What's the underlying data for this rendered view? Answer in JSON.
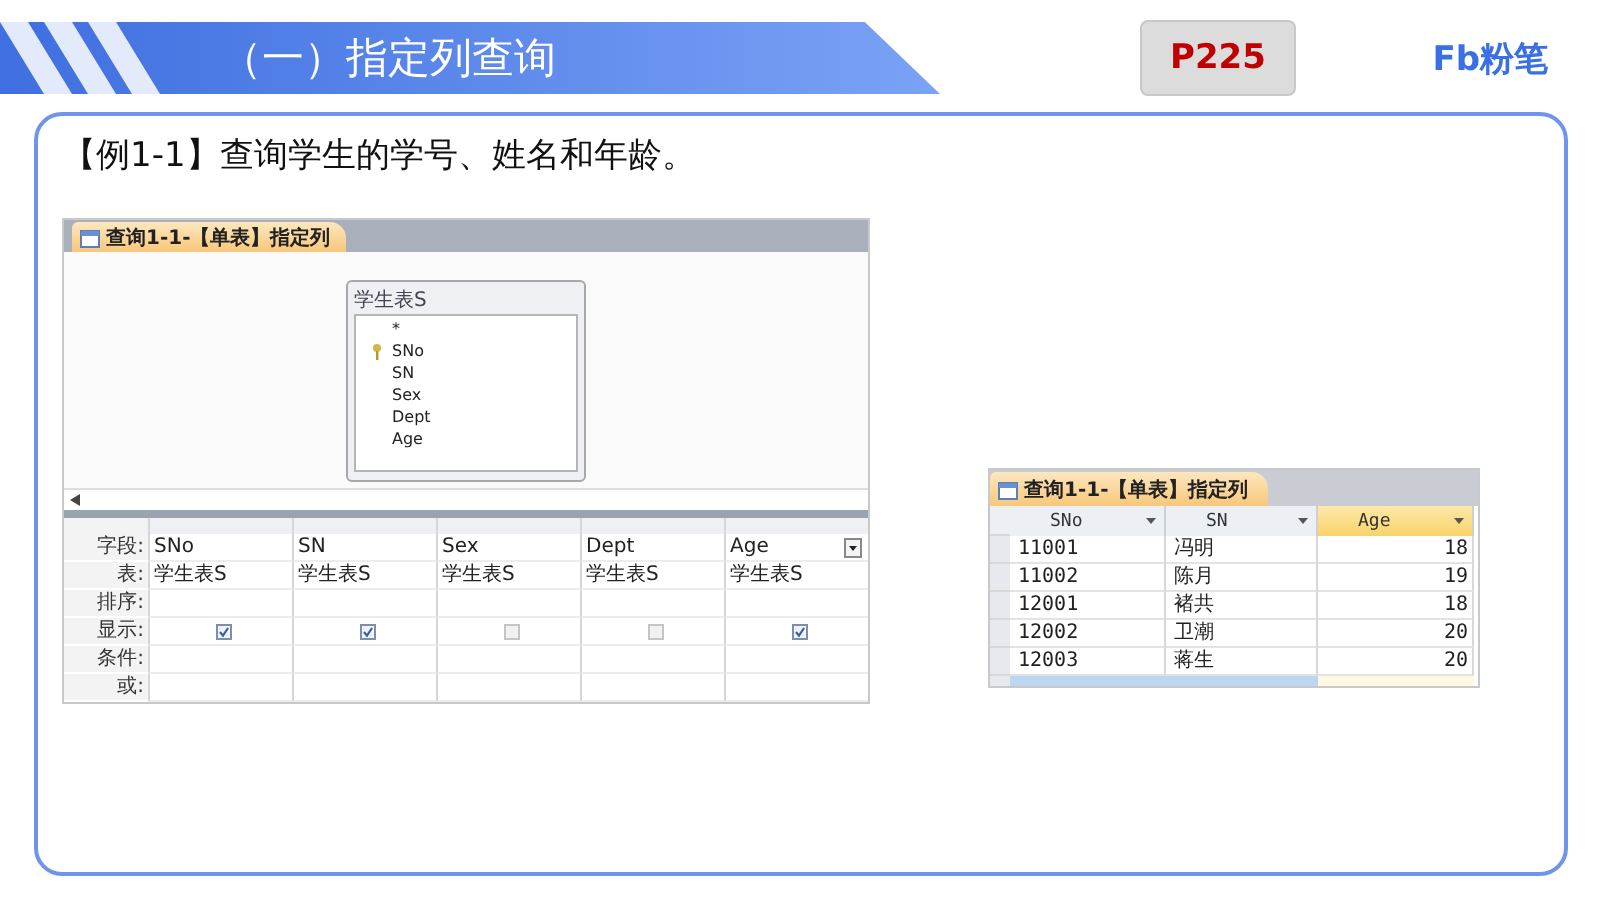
{
  "header": {
    "title": "（一）指定列查询",
    "page_badge": "P225",
    "logo": "Fb粉笔"
  },
  "question": "【例1-1】查询学生的学号、姓名和年龄。",
  "design_view": {
    "tab": "查询1-1-【单表】指定列",
    "table_box": {
      "title": "学生表S",
      "fields": [
        {
          "name": "*",
          "key": false
        },
        {
          "name": "SNo",
          "key": true
        },
        {
          "name": "SN",
          "key": false
        },
        {
          "name": "Sex",
          "key": false
        },
        {
          "name": "Dept",
          "key": false
        },
        {
          "name": "Age",
          "key": false
        }
      ]
    },
    "grid": {
      "row_labels": [
        "字段:",
        "表:",
        "排序:",
        "显示:",
        "条件:",
        "或:"
      ],
      "columns": [
        {
          "field": "SNo",
          "table": "学生表S",
          "show": true,
          "dropdown": false
        },
        {
          "field": "SN",
          "table": "学生表S",
          "show": true,
          "dropdown": false
        },
        {
          "field": "Sex",
          "table": "学生表S",
          "show": false,
          "dropdown": false
        },
        {
          "field": "Dept",
          "table": "学生表S",
          "show": false,
          "dropdown": false
        },
        {
          "field": "Age",
          "table": "学生表S",
          "show": true,
          "dropdown": true
        }
      ]
    }
  },
  "result_view": {
    "tab": "查询1-1-【单表】指定列",
    "columns": [
      {
        "label": "SNo",
        "highlighted": false
      },
      {
        "label": "SN",
        "highlighted": false
      },
      {
        "label": "Age",
        "highlighted": true
      }
    ],
    "rows": [
      [
        "11001",
        "冯明",
        "18"
      ],
      [
        "11002",
        "陈月",
        "19"
      ],
      [
        "12001",
        "褚共",
        "18"
      ],
      [
        "12002",
        "卫潮",
        "20"
      ],
      [
        "12003",
        "蒋生",
        "20"
      ]
    ]
  }
}
